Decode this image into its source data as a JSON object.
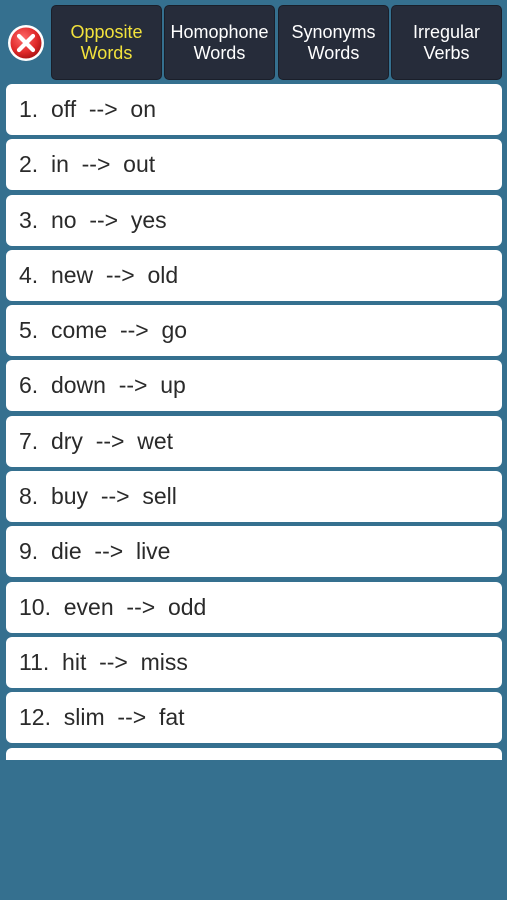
{
  "colors": {
    "background": "#35708f",
    "tab_bg": "#262c3a",
    "tab_active_text": "#f2e23c",
    "tab_text": "#ffffff",
    "close_red": "#e53030"
  },
  "close": {
    "icon": "close-icon"
  },
  "tabs": [
    {
      "line1": "Opposite",
      "line2": "Words",
      "active": true
    },
    {
      "line1": "Homophone",
      "line2": "Words",
      "active": false
    },
    {
      "line1": "Synonyms",
      "line2": "Words",
      "active": false
    },
    {
      "line1": "Irregular",
      "line2": "Verbs",
      "active": false
    }
  ],
  "items": [
    "1.  off  -->  on",
    "2.  in  -->  out",
    "3.  no  -->  yes",
    "4.  new  -->  old",
    "5.  come  -->  go",
    "6.  down  -->  up",
    "7.  dry  -->  wet",
    "8.  buy  -->  sell",
    "9.  die  -->  live",
    "10.  even  -->  odd",
    "11.  hit  -->  miss",
    "12.  slim  -->  fat",
    ""
  ]
}
